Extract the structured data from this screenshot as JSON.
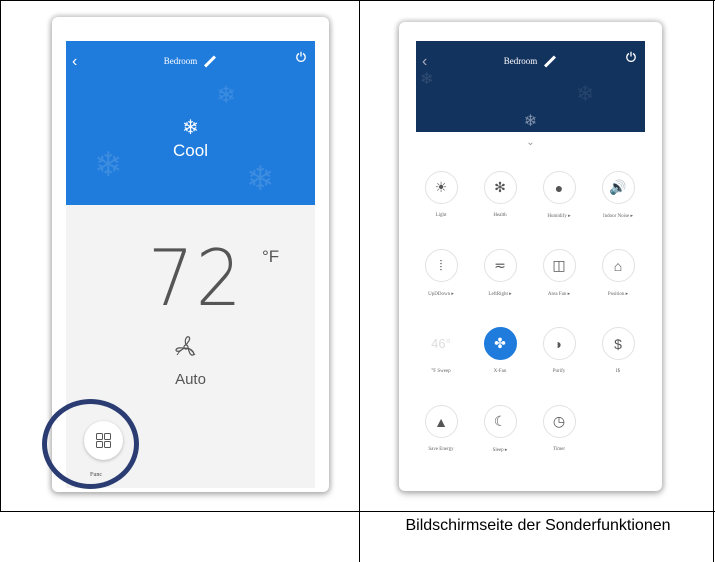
{
  "left_screen": {
    "room_title": "Bedroom",
    "mode_label": "Cool",
    "temperature": "72",
    "temperature_unit": "°F",
    "fan_label": "Auto",
    "func_label": "Func"
  },
  "right_screen": {
    "room_title": "Bedroom",
    "features": [
      {
        "label": "Light",
        "glyph": "☀"
      },
      {
        "label": "Health",
        "glyph": "✻"
      },
      {
        "label": "Humidify ▸",
        "glyph": "●"
      },
      {
        "label": "Indoor Noise ▸",
        "glyph": "🔊"
      },
      {
        "label": "UpDDown ▸",
        "glyph": "⦙"
      },
      {
        "label": "LeftRight ▸",
        "glyph": "≂"
      },
      {
        "label": "Area Fan ▸",
        "glyph": "◫"
      },
      {
        "label": "Position ▸",
        "glyph": "⌂"
      },
      {
        "label": "°F Sweep",
        "glyph": "46°"
      },
      {
        "label": "X-Fan",
        "glyph": "✤"
      },
      {
        "label": "Purify",
        "glyph": "◗"
      },
      {
        "label": "I$",
        "glyph": "$"
      },
      {
        "label": "Save Energy",
        "glyph": "▲"
      },
      {
        "label": "Sleep ▸",
        "glyph": "☾"
      },
      {
        "label": "Timer",
        "glyph": "◷"
      }
    ]
  },
  "caption": "Bildschirmseite der Sonderfunktionen",
  "colors": {
    "cool_blue": "#1f7bdc",
    "dark_navy": "#13335f",
    "highlight_ring": "#2a3c72"
  }
}
